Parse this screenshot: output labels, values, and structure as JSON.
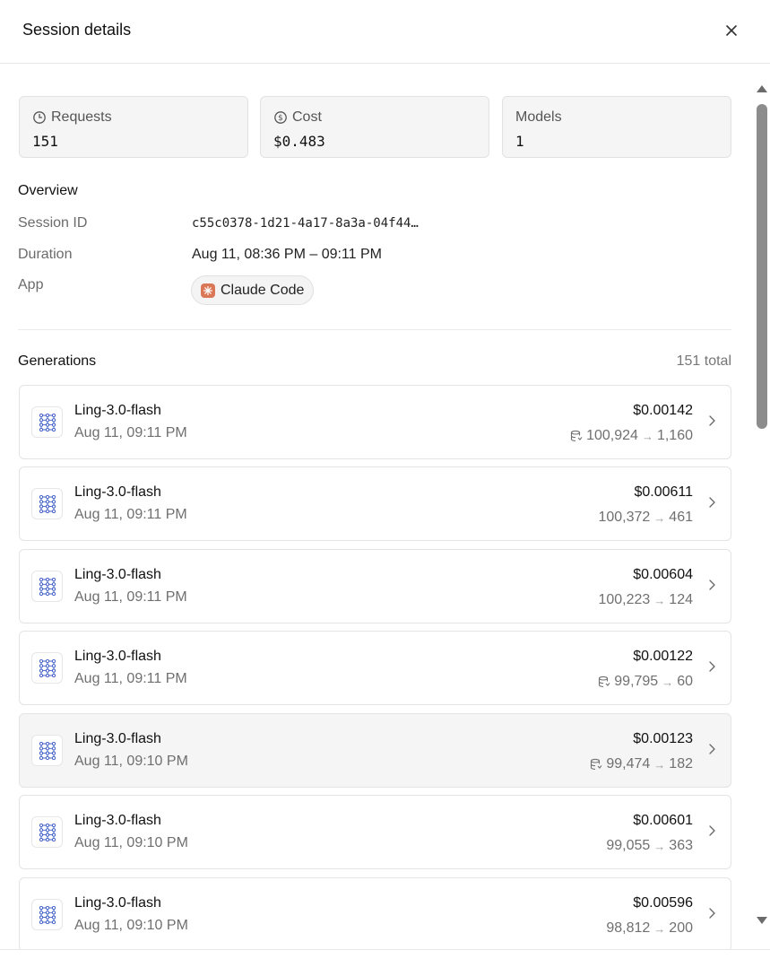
{
  "header": {
    "title": "Session details"
  },
  "stats": [
    {
      "label": "Requests",
      "value": "151",
      "icon": "clock-icon"
    },
    {
      "label": "Cost",
      "value": "$0.483",
      "icon": "dollar-circle-icon"
    },
    {
      "label": "Models",
      "value": "1"
    }
  ],
  "overview": {
    "title": "Overview",
    "session_id_label": "Session ID",
    "session_id": "c55c0378-1d21-4a17-8a3a-04f44…",
    "duration_label": "Duration",
    "duration": "Aug 11, 08:36 PM – 09:11 PM",
    "app_label": "App",
    "app": "Claude Code"
  },
  "generations": {
    "title": "Generations",
    "count": "151 total",
    "items": [
      {
        "model": "Ling-3.0-flash",
        "time": "Aug 11, 09:11 PM",
        "cost": "$0.00142",
        "cached": true,
        "input": "100,924",
        "output": "1,160"
      },
      {
        "model": "Ling-3.0-flash",
        "time": "Aug 11, 09:11 PM",
        "cost": "$0.00611",
        "cached": false,
        "input": "100,372",
        "output": "461"
      },
      {
        "model": "Ling-3.0-flash",
        "time": "Aug 11, 09:11 PM",
        "cost": "$0.00604",
        "cached": false,
        "input": "100,223",
        "output": "124"
      },
      {
        "model": "Ling-3.0-flash",
        "time": "Aug 11, 09:11 PM",
        "cost": "$0.00122",
        "cached": true,
        "input": "99,795",
        "output": "60"
      },
      {
        "model": "Ling-3.0-flash",
        "time": "Aug 11, 09:10 PM",
        "cost": "$0.00123",
        "cached": true,
        "input": "99,474",
        "output": "182"
      },
      {
        "model": "Ling-3.0-flash",
        "time": "Aug 11, 09:10 PM",
        "cost": "$0.00601",
        "cached": false,
        "input": "99,055",
        "output": "363"
      },
      {
        "model": "Ling-3.0-flash",
        "time": "Aug 11, 09:10 PM",
        "cost": "$0.00596",
        "cached": false,
        "input": "98,812",
        "output": "200"
      }
    ]
  }
}
